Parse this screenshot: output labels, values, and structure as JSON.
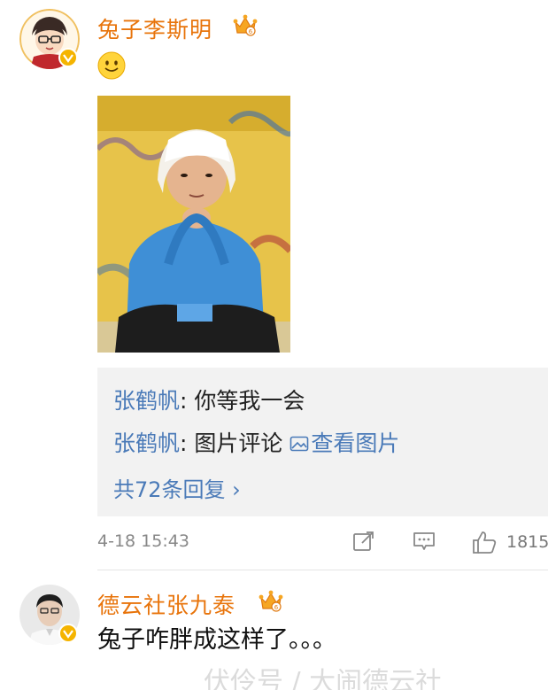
{
  "post": {
    "author": "兔子李斯明",
    "emoji": "smiley-emoji-icon"
  },
  "replies": {
    "items": [
      {
        "author": "张鹤帆",
        "sep": ": ",
        "text": "你等我一会"
      },
      {
        "author": "张鹤帆",
        "sep": ": ",
        "text": "图片评论 ",
        "link": "查看图片"
      }
    ],
    "more": "共72条回复 ›"
  },
  "meta": {
    "time": "4-18 15:43",
    "likes": "1815",
    "icons": [
      "share-icon",
      "comment-icon",
      "like-icon"
    ]
  },
  "comment": {
    "author": "德云社张九泰",
    "text": "兔子咋胖成这样了。。。"
  },
  "watermark": "伏伶号 / 大闹德云社",
  "colors": {
    "username": "#e8740b",
    "link": "#4a7ab8",
    "badge": "#f5b400",
    "reply_bg": "#f2f2f2"
  }
}
